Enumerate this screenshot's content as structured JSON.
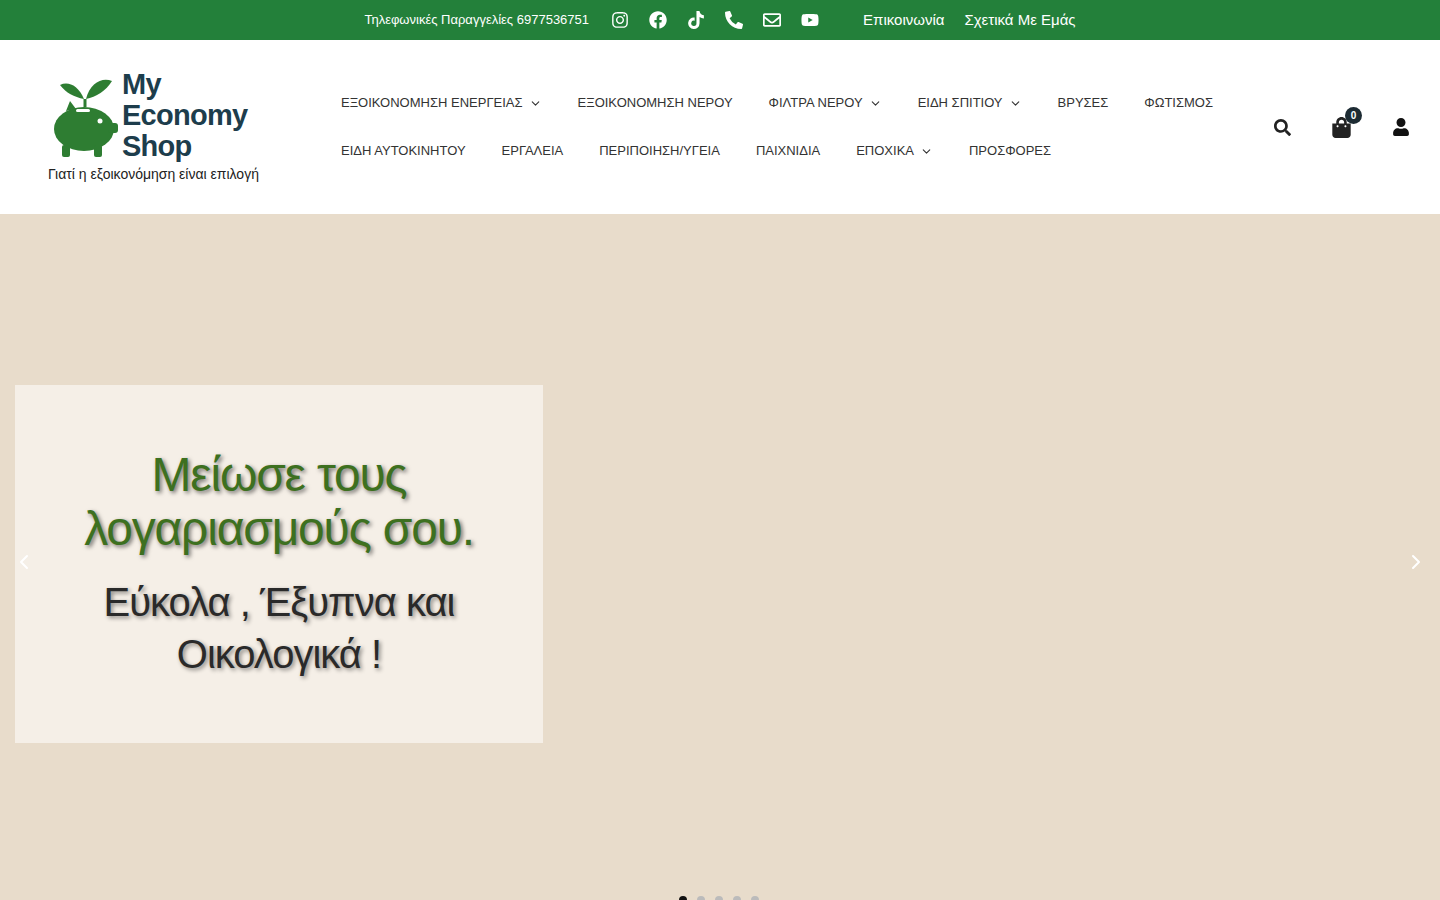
{
  "topbar": {
    "phone_text": "Τηλεφωνικές Παραγγελίες 6977536751",
    "links": [
      "Επικοινωνία",
      "Σχετικά Με Εμάς"
    ]
  },
  "logo": {
    "lines": [
      "My",
      "Economy",
      "Shop"
    ],
    "tagline": "Γιατί η εξοικονόμηση είναι επιλογή"
  },
  "nav_rows": [
    [
      {
        "label": "ΕΞΟΙΚΟΝΟΜΗΣΗ ΕΝΕΡΓΕΙΑΣ",
        "has_dropdown": true
      },
      {
        "label": "ΕΞΟΙΚΟΝΟΜΗΣΗ ΝΕΡΟΥ",
        "has_dropdown": false
      },
      {
        "label": "ΦΙΛΤΡΑ ΝΕΡΟΥ",
        "has_dropdown": true
      },
      {
        "label": "ΕΙΔΗ ΣΠΙΤΙΟΥ",
        "has_dropdown": true
      },
      {
        "label": "ΒΡΥΣΕΣ",
        "has_dropdown": false
      },
      {
        "label": "ΦΩΤΙΣΜΟΣ",
        "has_dropdown": false
      }
    ],
    [
      {
        "label": "ΕΙΔΗ ΑΥΤΟΚΙΝΗΤΟΥ",
        "has_dropdown": false
      },
      {
        "label": "ΕΡΓΑΛΕΙΑ",
        "has_dropdown": false
      },
      {
        "label": "ΠΕΡΙΠΟΙΗΣΗ/ΥΓΕΙΑ",
        "has_dropdown": false
      },
      {
        "label": "ΠΑΙΧΝΙΔΙΑ",
        "has_dropdown": false
      },
      {
        "label": "ΕΠΟΧΙΚΑ",
        "has_dropdown": true
      },
      {
        "label": "ΠΡΟΣΦΟΡΕΣ",
        "has_dropdown": false
      }
    ]
  ],
  "cart": {
    "count": "0"
  },
  "hero": {
    "headline_lines": [
      "Μείωσε τους",
      "λογαριασμούς σου."
    ],
    "subline_lines": [
      "Εύκολα , Έξυπνα και",
      "Οικολογικά !"
    ],
    "slides": [
      {
        "selected": true
      },
      {
        "selected": false
      },
      {
        "selected": false
      },
      {
        "selected": false
      },
      {
        "selected": false
      }
    ]
  }
}
